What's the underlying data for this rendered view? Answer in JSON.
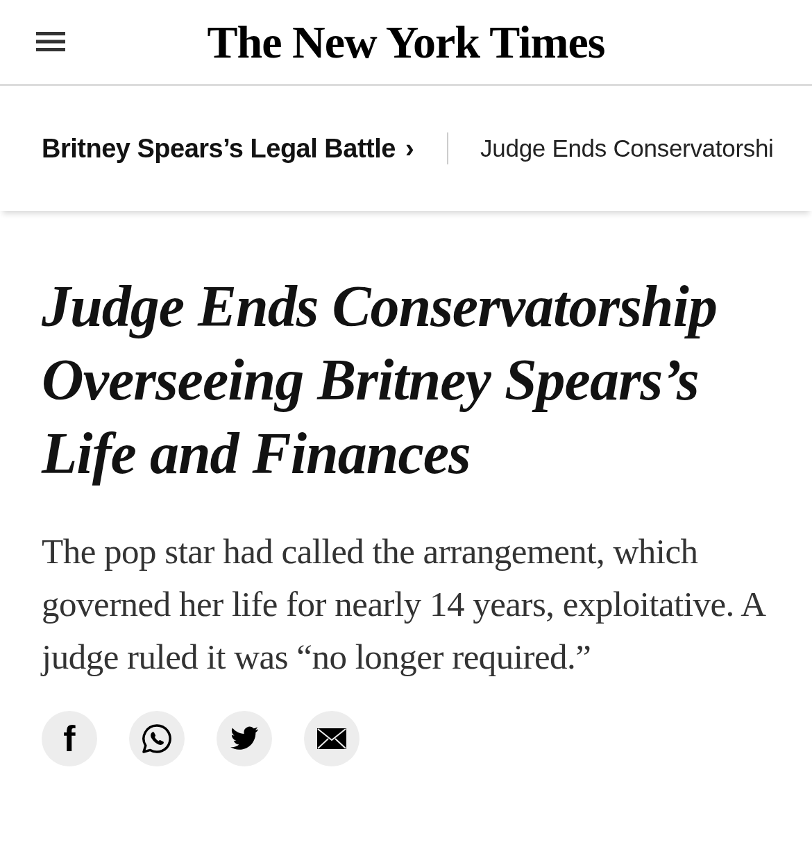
{
  "header": {
    "logo": "The New York Times"
  },
  "breadcrumbs": [
    {
      "label": "Britney Spears’s Legal Battle",
      "separator": "›"
    },
    {
      "label": "Judge Ends Conservatorshi"
    }
  ],
  "article": {
    "headline": "Judge Ends Conservatorship Overseeing Britney Spears’s Life and Finances",
    "summary": "The pop star had called the arrangement, which governed her life for nearly 14 years, exploitative. A judge ruled it was “no longer required.”"
  },
  "share_buttons": [
    {
      "kind": "letter",
      "text": "f"
    },
    {
      "kind": "chat"
    },
    {
      "kind": "bird"
    },
    {
      "kind": "mail"
    }
  ]
}
